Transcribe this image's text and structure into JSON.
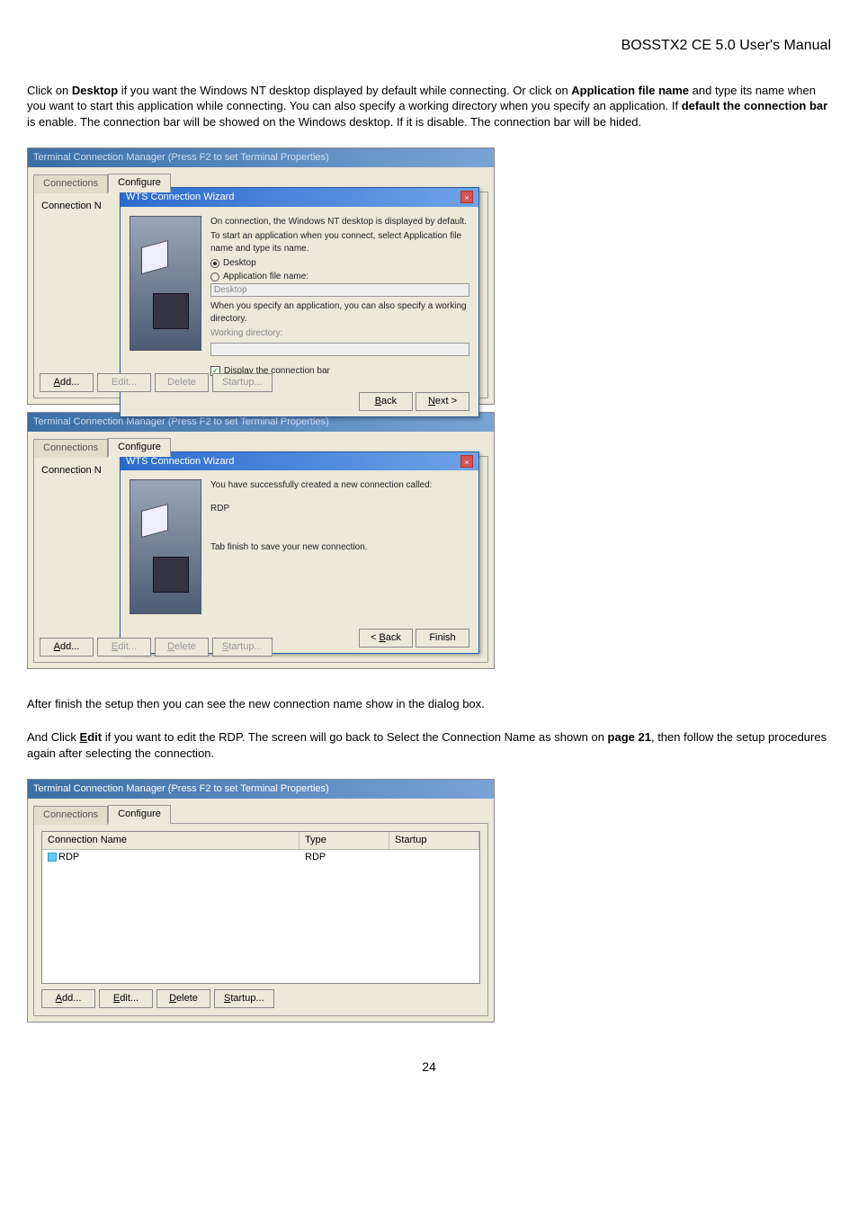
{
  "header": {
    "title": "BOSSTX2 CE 5.0 User's Manual"
  },
  "para1": {
    "prefix": "Click on ",
    "b1": "Desktop",
    "mid1": " if you want the Windows NT desktop displayed by default while connecting. Or click on ",
    "b2": "Application file name",
    "mid2": " and type its name when you want to start this application while connecting. You can also specify a working directory when you specify an application. If ",
    "b3": "default the connection bar",
    "mid3": " is enable. The connection bar will be showed on the Windows desktop. If it is disable. The connection bar will be hided."
  },
  "para2": "After finish the setup then you can see the new connection name show in the dialog box.",
  "para3": {
    "prefix": "And Click ",
    "edit": "Edit",
    "mid1": " if you want to edit the RDP. The screen will go back to Select the Connection Name as shown on ",
    "page": "page 21",
    "suffix": ", then follow the setup procedures again after selecting the connection."
  },
  "win": {
    "title_faded": "Terminal Connection Manager (Press F2 to set Terminal Properties)",
    "title_clear": "Terminal Connection Manager (Press F2 to set Terminal Properties)",
    "tab_connections": "Connections",
    "tab_configure": "Configure",
    "conn_col_trunc": "Connection N",
    "wizard_title": "WTS Connection Wizard",
    "wiz1_line1": "On connection, the Windows NT desktop is displayed by default.",
    "wiz1_line2": "To start an application when you connect, select Application file name and type its name.",
    "wiz1_opt_desktop": "Desktop",
    "wiz1_opt_appfile": "Application file name:",
    "wiz1_placeholder_app": "Desktop",
    "wiz1_line3": "When you specify an application, you can also specify a working directory.",
    "wiz1_workdir": "Working directory:",
    "wiz1_checkbox": "Display the connection bar",
    "wiz2_line1": "You have successfully created a new connection called:",
    "wiz2_conn_name": "RDP",
    "wiz2_line2": "Tab finish to save your new connection.",
    "btn_back": "< Back",
    "btn_next": "Next >",
    "btn_finish": "Finish",
    "btn_add": "Add...",
    "btn_edit": "Edit...",
    "btn_delete": "Delete",
    "btn_startup": "Startup...",
    "list_col_name": "Connection Name",
    "list_col_type": "Type",
    "list_col_startup": "Startup",
    "list_row_name": "RDP",
    "list_row_type": "RDP",
    "list_row_startup": ""
  },
  "page_number": "24"
}
